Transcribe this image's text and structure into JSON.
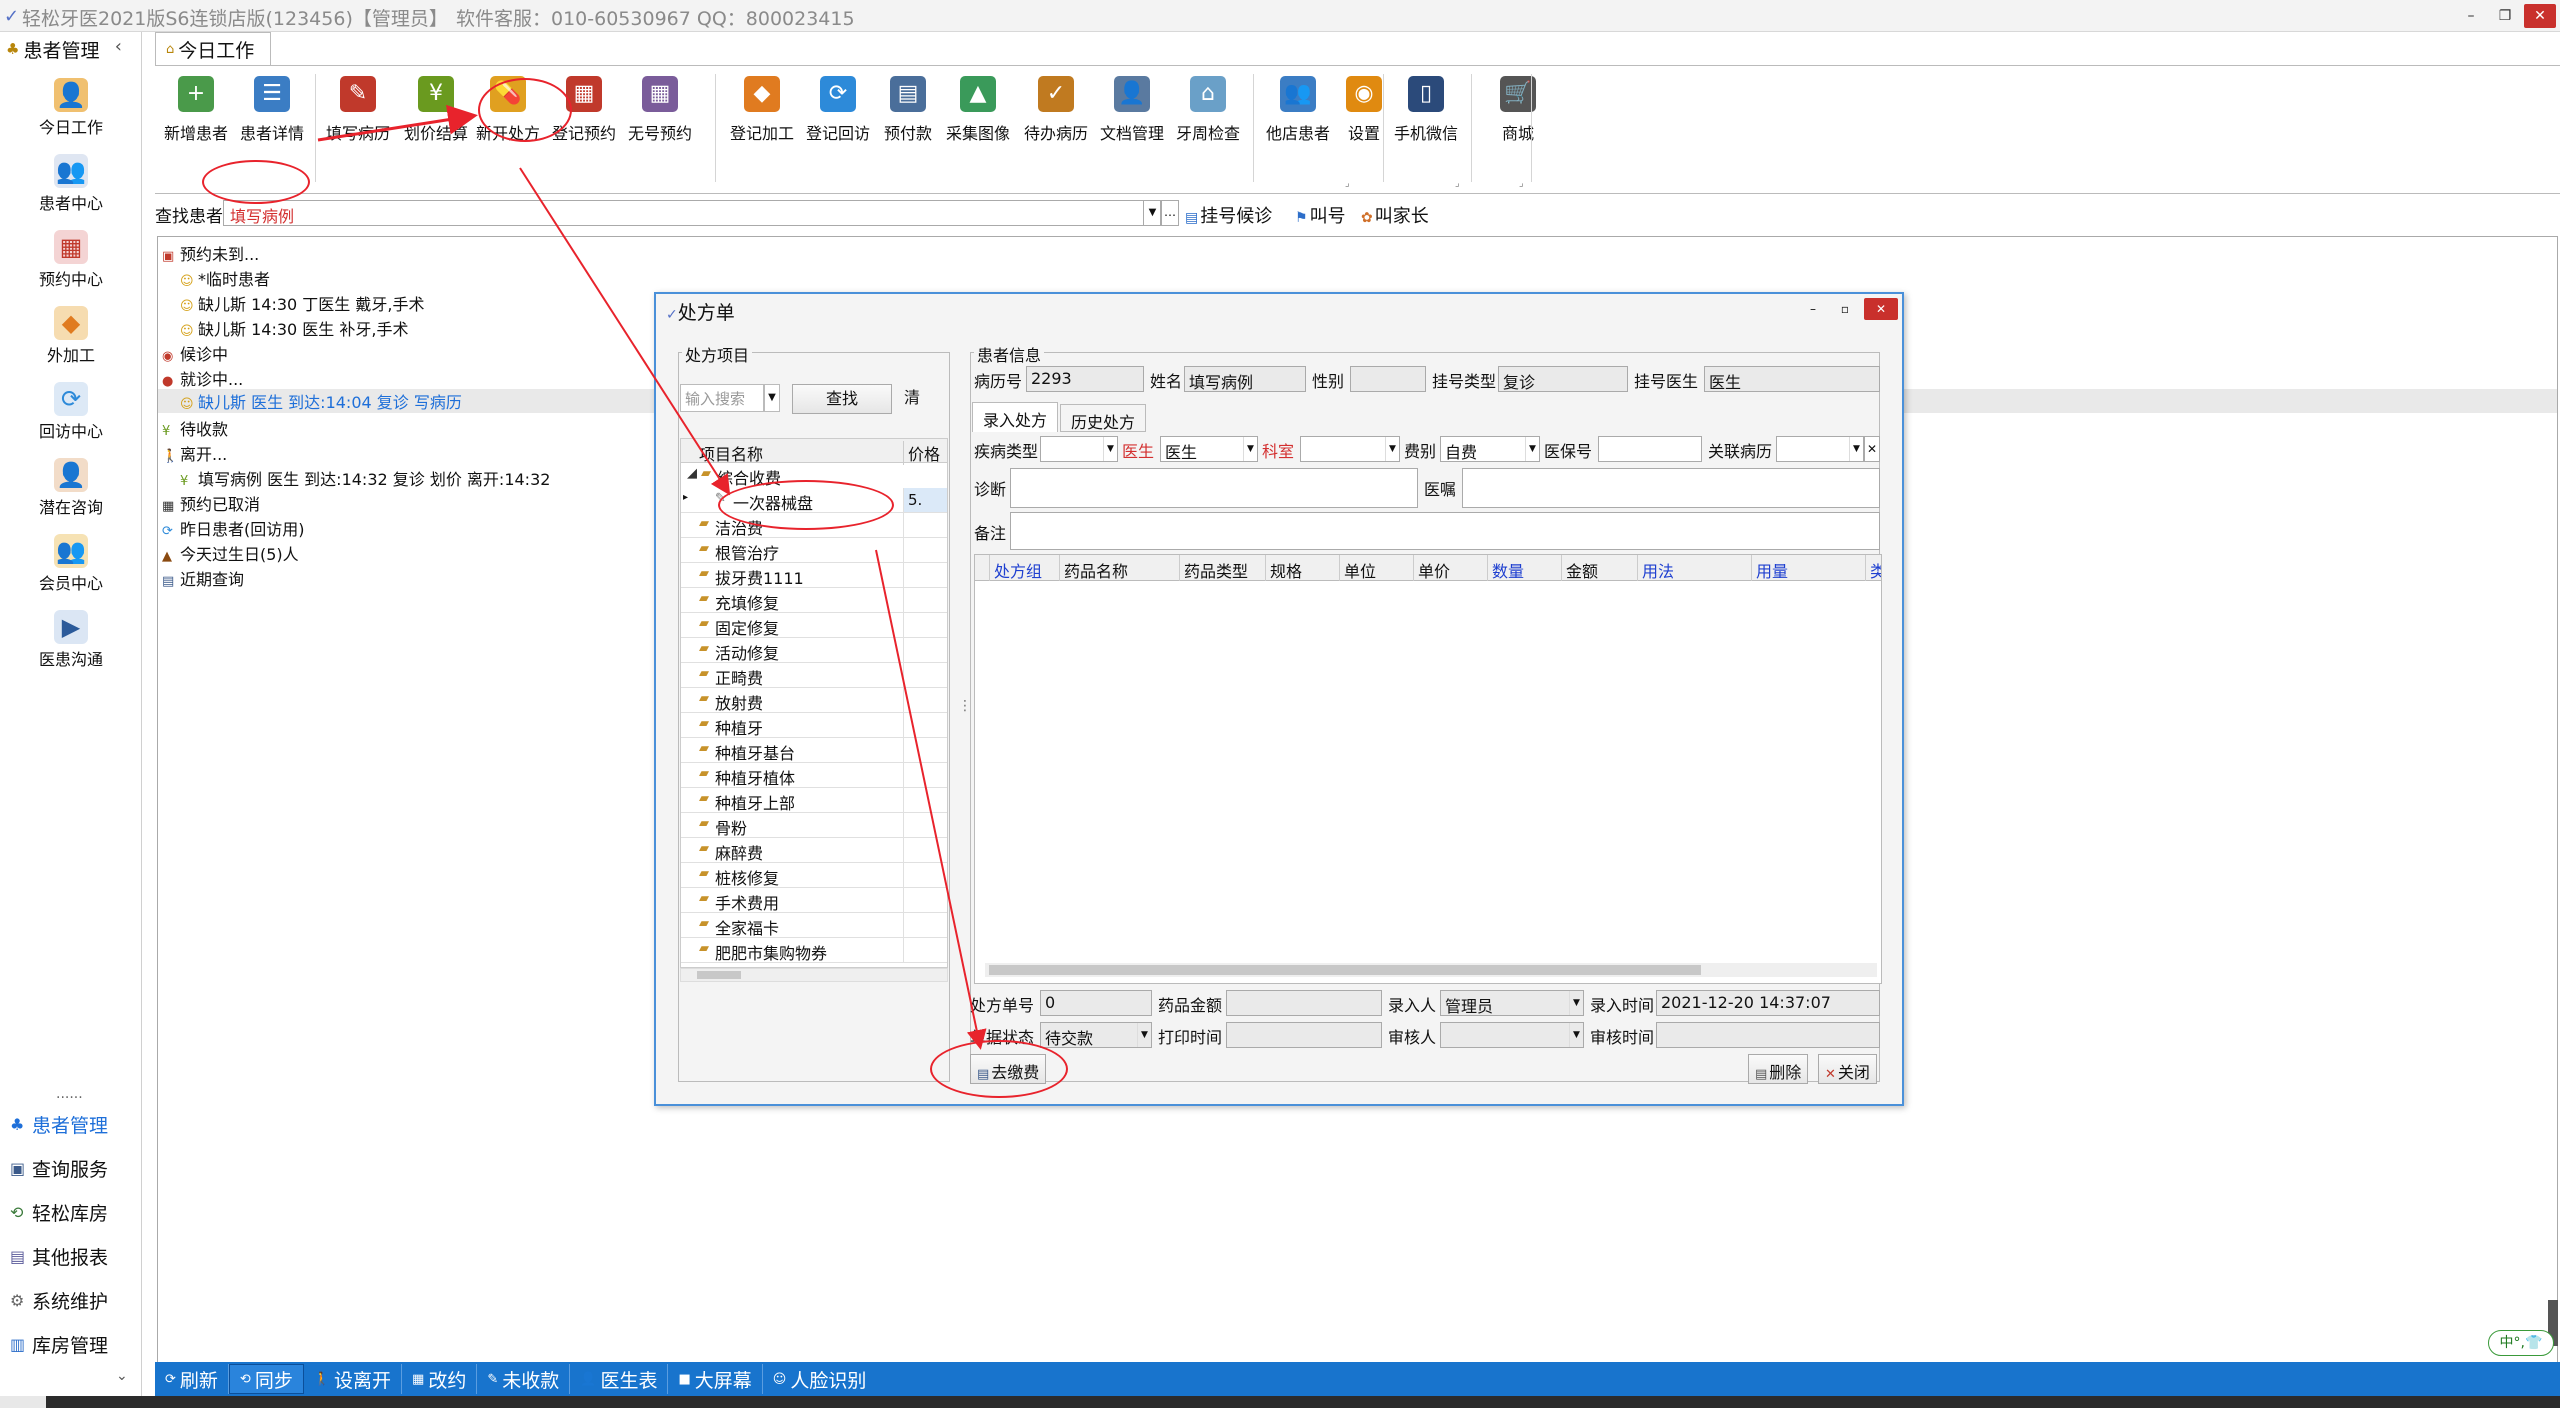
{
  "titlebar": {
    "title": "轻松牙医2021版S6连锁店版(123456)【管理员】",
    "service": "软件客服：010-60530967 QQ：800023415"
  },
  "sidebar": {
    "header": "患者管理",
    "items": [
      {
        "label": "今日工作",
        "icon": "person-desk-icon"
      },
      {
        "label": "患者中心",
        "icon": "people-search-icon"
      },
      {
        "label": "预约中心",
        "icon": "calendar-icon"
      },
      {
        "label": "外加工",
        "icon": "cubes-icon"
      },
      {
        "label": "回访中心",
        "icon": "refresh-icon"
      },
      {
        "label": "潜在咨询",
        "icon": "consult-icon"
      },
      {
        "label": "会员中心",
        "icon": "members-icon"
      },
      {
        "label": "医患沟通",
        "icon": "video-icon"
      }
    ],
    "separator": "......",
    "bottom": [
      {
        "label": "患者管理"
      },
      {
        "label": "查询服务"
      },
      {
        "label": "轻松库房"
      },
      {
        "label": "其他报表"
      },
      {
        "label": "系统维护"
      },
      {
        "label": "库房管理"
      }
    ]
  },
  "main_tab": "今日工作",
  "ribbon": {
    "buttons": [
      {
        "label": "新增患者",
        "icon": "add-patient-icon",
        "color": "#4a9a4a"
      },
      {
        "label": "患者详情",
        "icon": "patient-card-icon",
        "color": "#3b7dc4"
      },
      {
        "label": "填写病历",
        "icon": "medical-record-icon",
        "color": "#c0392b"
      },
      {
        "label": "划价结算",
        "icon": "yuan-icon",
        "color": "#6a9a1f"
      },
      {
        "label": "新开处方",
        "icon": "pill-icon",
        "color": "#e0a020"
      },
      {
        "label": "登记预约",
        "icon": "calendar-icon",
        "color": "#c0392b"
      },
      {
        "label": "无号预约",
        "icon": "calendar-grid-icon",
        "color": "#7a5c9a"
      },
      {
        "label": "登记加工",
        "icon": "cubes-icon",
        "color": "#e07b20"
      },
      {
        "label": "登记回访",
        "icon": "refresh-icon",
        "color": "#2d8ad9"
      },
      {
        "label": "预付款",
        "icon": "calculator-icon",
        "color": "#4a6e9a"
      },
      {
        "label": "采集图像",
        "icon": "image-icon",
        "color": "#3a9a5a"
      },
      {
        "label": "待办病历",
        "icon": "todo-record-icon",
        "color": "#c07a20"
      },
      {
        "label": "文档管理",
        "icon": "document-icon",
        "color": "#5a7aa0"
      },
      {
        "label": "牙周检查",
        "icon": "tooth-icon",
        "color": "#6aa0c8"
      },
      {
        "label": "他店患者",
        "icon": "other-store-icon",
        "color": "#3b7dc4"
      },
      {
        "label": "设置",
        "icon": "rss-settings-icon",
        "color": "#e08a10"
      },
      {
        "label": "手机微信",
        "icon": "phone-icon",
        "color": "#2b4a7a"
      },
      {
        "label": "商城",
        "icon": "cart-icon",
        "color": "#555555"
      }
    ]
  },
  "search": {
    "label": "查找患者",
    "value": "填写病例",
    "actions": [
      "挂号候诊",
      "叫号",
      "叫家长"
    ]
  },
  "tree": {
    "nodes": [
      {
        "text": "预约未到..."
      },
      {
        "text": "*临时患者"
      },
      {
        "text": "缺儿斯 14:30 丁医生 戴牙,手术"
      },
      {
        "text": "缺儿斯 14:30 医生   补牙,手术"
      },
      {
        "text": "候诊中"
      },
      {
        "text": "就诊中..."
      },
      {
        "text": "缺儿斯        医生   到达:14:04 复诊 写病历"
      },
      {
        "text": "待收款"
      },
      {
        "text": "离开..."
      },
      {
        "text": "填写病例       医生   到达:14:32 复诊 划价 离开:14:32"
      },
      {
        "text": "预约已取消"
      },
      {
        "text": "昨日患者(回访用)"
      },
      {
        "text": "今天过生日(5)人"
      },
      {
        "text": "近期查询"
      }
    ]
  },
  "dialog": {
    "title": "处方单",
    "left": {
      "legend": "处方项目",
      "search_placeholder": "输入搜索",
      "find_label": "查找",
      "clear_label": "清",
      "col_name": "项目名称",
      "col_price": "价格",
      "root": "综合收费",
      "rows": [
        {
          "name": "一次器械盘",
          "price": "5."
        },
        {
          "name": "洁治费",
          "price": ""
        },
        {
          "name": "根管治疗",
          "price": ""
        },
        {
          "name": "拔牙费1111",
          "price": ""
        },
        {
          "name": "充填修复",
          "price": ""
        },
        {
          "name": "固定修复",
          "price": ""
        },
        {
          "name": "活动修复",
          "price": ""
        },
        {
          "name": "正畸费",
          "price": ""
        },
        {
          "name": "放射费",
          "price": ""
        },
        {
          "name": "种植牙",
          "price": ""
        },
        {
          "name": "种植牙基台",
          "price": ""
        },
        {
          "name": "种植牙植体",
          "price": ""
        },
        {
          "name": "种植牙上部",
          "price": ""
        },
        {
          "name": "骨粉",
          "price": ""
        },
        {
          "name": "麻醉费",
          "price": ""
        },
        {
          "name": "桩核修复",
          "price": ""
        },
        {
          "name": "手术费用",
          "price": ""
        },
        {
          "name": "全家福卡",
          "price": ""
        },
        {
          "name": "肥肥市集购物券",
          "price": ""
        }
      ]
    },
    "right": {
      "legend": "患者信息",
      "record_no_label": "病历号",
      "record_no": "2293",
      "name_label": "姓名",
      "name": "填写病例",
      "gender_label": "性别",
      "gender": "",
      "reg_type_label": "挂号类型",
      "reg_type": "复诊",
      "reg_doctor_label": "挂号医生",
      "reg_doctor": "医生",
      "tabs": [
        "录入处方",
        "历史处方"
      ],
      "disease_type_label": "疾病类型",
      "doctor_label": "医生",
      "doctor_value": "医生",
      "dept_label": "科室",
      "fee_label": "费别",
      "fee_value": "自费",
      "insurance_label": "医保号",
      "related_label": "关联病历",
      "diagnosis_label": "诊断",
      "advice_label": "医嘱",
      "note_label": "备注",
      "columns": [
        {
          "label": "处方组",
          "blue": true
        },
        {
          "label": "药品名称",
          "blue": false
        },
        {
          "label": "药品类型",
          "blue": false
        },
        {
          "label": "规格",
          "blue": false
        },
        {
          "label": "单位",
          "blue": false
        },
        {
          "label": "单价",
          "blue": false
        },
        {
          "label": "数量",
          "blue": true
        },
        {
          "label": "金额",
          "blue": false
        },
        {
          "label": "用法",
          "blue": true
        },
        {
          "label": "用量",
          "blue": true
        },
        {
          "label": "类",
          "blue": true
        }
      ],
      "rx_no_label": "处方单号",
      "rx_no": "0",
      "drug_amount_label": "药品金额",
      "entry_person_label": "录入人",
      "entry_person": "管理员",
      "entry_time_label": "录入时间",
      "entry_time": "2021-12-20 14:37:07",
      "status_label": "单据状态",
      "status": "待交款",
      "print_time_label": "打印时间",
      "reviewer_label": "审核人",
      "review_time_label": "审核时间"
    },
    "pay_button": "去缴费",
    "delete_button": "删除",
    "close_button": "关闭"
  },
  "statusbar": {
    "buttons": [
      "刷新",
      "同步",
      "设离开",
      "改约",
      "未收款",
      "医生表",
      "大屏幕",
      "人脸识别"
    ]
  },
  "tray": "中°,👕"
}
